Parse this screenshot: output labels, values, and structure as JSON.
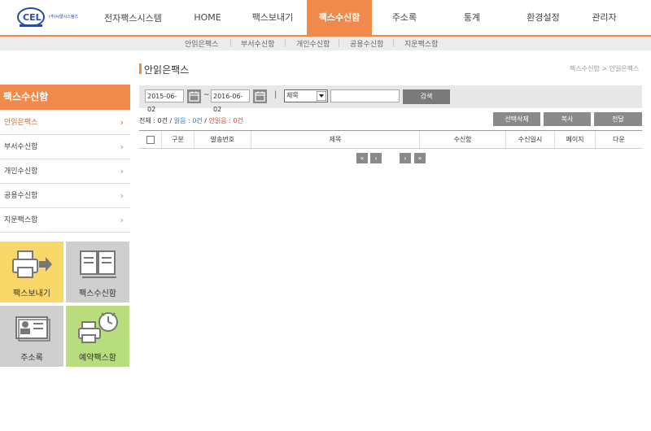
{
  "header": {
    "logo_text": "(주)씨엘시스템즈",
    "brand": "전자팩스시스템",
    "nav": [
      "HOME",
      "팩스보내기",
      "팩스수신함",
      "주소록",
      "통계",
      "환경설정",
      "관리자"
    ]
  },
  "subnav": [
    "안읽은팩스",
    "부서수신함",
    "개인수신함",
    "공용수신함",
    "지운팩스함"
  ],
  "sidebar": {
    "title": "팩스수신함",
    "items": [
      "안읽은팩스",
      "부서수신함",
      "개인수신함",
      "공용수신함",
      "지운팩스함"
    ],
    "chevron": "›",
    "tiles": [
      "팩스보내기",
      "팩스수신함",
      "주소록",
      "예약팩스함"
    ]
  },
  "main": {
    "title": "안읽은팩스",
    "breadcrumb": "팩스수신함 > 안읽은팩스",
    "search": {
      "start_date": "2015-06-02",
      "tilde": "~",
      "end_date": "2016-06-02",
      "divider": "|",
      "select_value": "제목",
      "search_value": "",
      "search_label": "검색"
    },
    "counts": {
      "total": "전체 : 0건",
      "sep1": " / ",
      "read": "읽음 : 0건",
      "sep2": " / ",
      "unread": "안읽음 : 0건"
    },
    "actions": [
      "선택삭제",
      "복사",
      "전달"
    ],
    "columns": [
      "구분",
      "발송번호",
      "제목",
      "수신함",
      "수신일시",
      "페이지",
      "다운"
    ],
    "pagination": [
      "«",
      "‹",
      "›",
      "»"
    ]
  },
  "colors": {
    "accent": "#f08a4b",
    "tile_yellow": "#f9d768",
    "tile_gray": "#cfcfcf",
    "tile_green": "#b7dd7d"
  }
}
